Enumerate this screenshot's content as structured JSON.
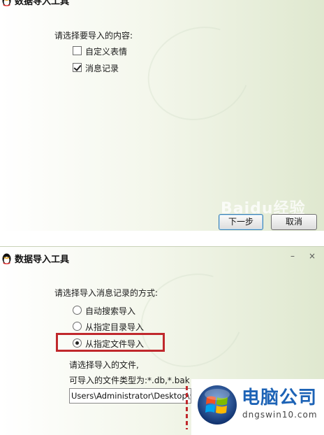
{
  "window1": {
    "title": "数据导入工具",
    "prompt": "请选择要导入的内容:",
    "options": [
      {
        "label": "自定义表情",
        "checked": false
      },
      {
        "label": "消息记录",
        "checked": true
      }
    ],
    "next_button": "下一步",
    "cancel_button": "取消",
    "watermark": "Baidu经验"
  },
  "window2": {
    "title": "数据导入工具",
    "minimize": "–",
    "close": "×",
    "prompt": "请选择导入消息记录的方式:",
    "options": [
      {
        "label": "自动搜索导入",
        "selected": false
      },
      {
        "label": "从指定目录导入",
        "selected": false
      },
      {
        "label": "从指定文件导入",
        "selected": true
      }
    ],
    "file_prompt": "请选择导入的文件,",
    "file_types": "可导入的文件类型为:*.db,*.bak",
    "path_value": "Users\\Administrator\\Desktop\\全"
  },
  "brand": {
    "name": "电脑公司",
    "url": "dngswin10.com"
  },
  "colors": {
    "highlight_red": "#c0282c",
    "brand_blue": "#1d63b6"
  }
}
